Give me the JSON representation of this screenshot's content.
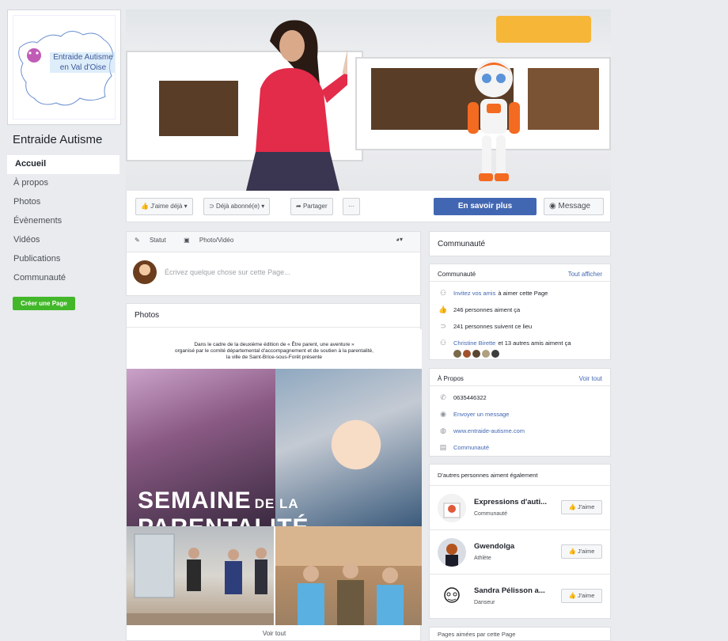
{
  "left": {
    "logo_text_1": "Entraide Autisme",
    "logo_text_2": "en Val d'Oise",
    "page_name": "Entraide Autisme",
    "nav": [
      "Accueil",
      "À propos",
      "Photos",
      "Évènements",
      "Vidéos",
      "Publications",
      "Communauté"
    ],
    "create_page": "Créer une Page"
  },
  "actions": {
    "like": "J'aime déjà ▾",
    "follow": "Déjà abonné(e) ▾",
    "share": "Partager",
    "more": "···",
    "learn_more": "En savoir plus",
    "message": "Message"
  },
  "composer": {
    "status": "Statut",
    "photo_video": "Photo/Vidéo",
    "placeholder": "Écrivez quelque chose sur cette Page..."
  },
  "photos": {
    "title": "Photos",
    "poster_caption_1": "Dans le cadre de la deuxième édition de « Être parent, une aventure »",
    "poster_caption_2": "organisé par le comité départemental d'accompagnement et de soutien à la parentalité,",
    "poster_caption_3": "la ville de Saint-Brice-sous-Forêt présente",
    "poster_title_1": "SEMAINE",
    "poster_title_small": "DE LA",
    "poster_title_2": "PARENTALITÉ",
    "see_all": "Voir tout"
  },
  "community": {
    "header": "Communauté",
    "title": "Communauté",
    "view_all": "Tout afficher",
    "invite_link": "Invitez vos amis",
    "invite_rest": "à aimer cette Page",
    "likes": "246 personnes aiment ça",
    "followers": "241 personnes suivent ce lieu",
    "friend_link": "Christine Birette",
    "friend_rest": "et 13 autres amis aiment ça"
  },
  "about": {
    "title": "À Propos",
    "view_all": "Voir tout",
    "phone": "0635446322",
    "message": "Envoyer un message",
    "website": "www.entraide-autisme.com",
    "category": "Communauté"
  },
  "similar": {
    "title": "D'autres personnes aiment également",
    "like_label": "J'aime",
    "items": [
      {
        "name": "Expressions d'auti...",
        "category": "Communauté"
      },
      {
        "name": "Gwendolga",
        "category": "Athlète"
      },
      {
        "name": "Sandra Pélisson a...",
        "category": "Danseur"
      }
    ]
  },
  "bottom": {
    "text": "Pages aimées par cette Page"
  },
  "colors": {
    "accent": "#4267b2",
    "create_green": "#42b72a",
    "background": "#e9ebee"
  }
}
